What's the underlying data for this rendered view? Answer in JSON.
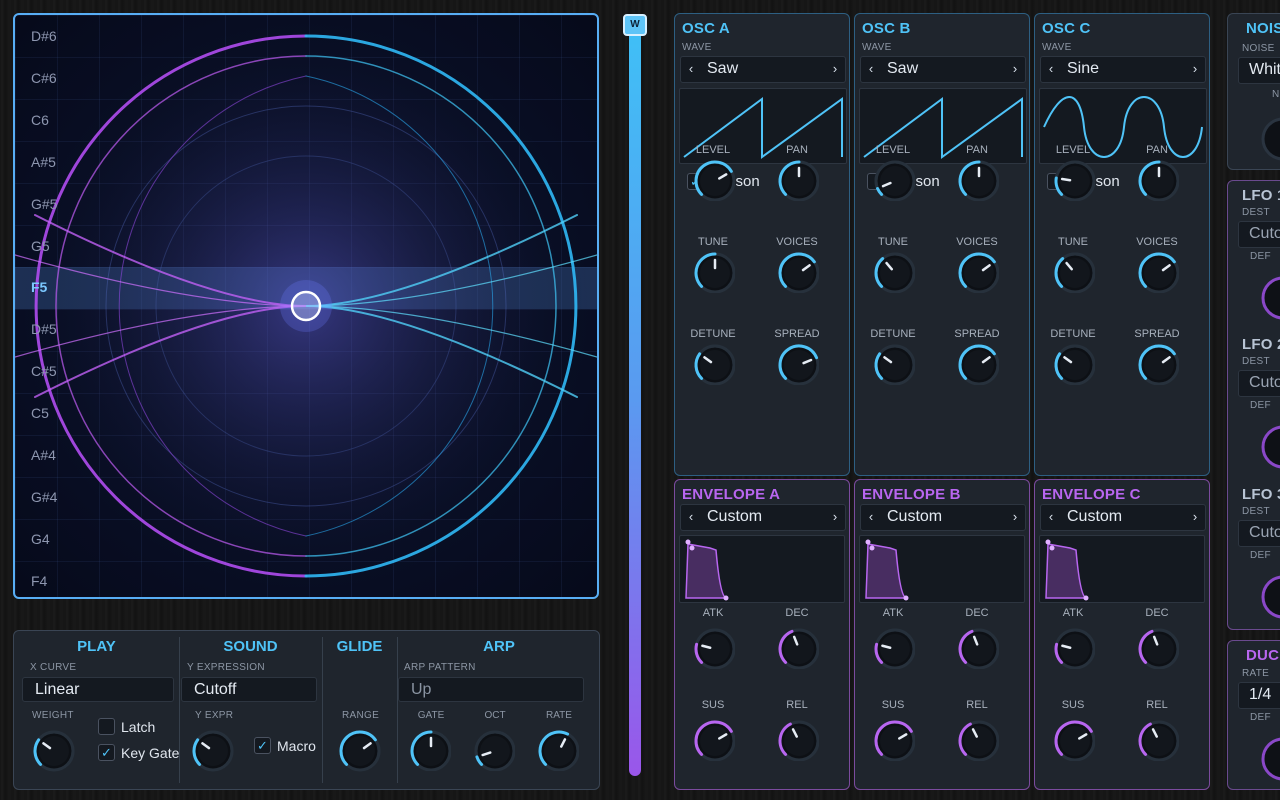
{
  "xy_pad": {
    "notes": [
      "D#6",
      "C#6",
      "C6",
      "A#5",
      "G#5",
      "G5",
      "F5",
      "D#5",
      "C#5",
      "C5",
      "A#4",
      "G#4",
      "G4",
      "F4"
    ],
    "active_note": "F5"
  },
  "slider": {
    "thumb_label": "W"
  },
  "oscillators": [
    {
      "title": "OSC A",
      "wave_label": "WAVE",
      "wave": "Saw",
      "unison_label": "Unison",
      "unison": true,
      "knobs": [
        {
          "label": "LEVEL",
          "value": 0.72
        },
        {
          "label": "PAN",
          "value": 0.5
        },
        {
          "label": "TUNE",
          "value": 0.5
        },
        {
          "label": "VOICES",
          "value": 0.7
        },
        {
          "label": "DETUNE",
          "value": 0.3
        },
        {
          "label": "SPREAD",
          "value": 0.75
        }
      ]
    },
    {
      "title": "OSC B",
      "wave_label": "WAVE",
      "wave": "Saw",
      "unison_label": "Unison",
      "unison": false,
      "knobs": [
        {
          "label": "LEVEL",
          "value": 0.08
        },
        {
          "label": "PAN",
          "value": 0.5
        },
        {
          "label": "TUNE",
          "value": 0.35
        },
        {
          "label": "VOICES",
          "value": 0.7
        },
        {
          "label": "DETUNE",
          "value": 0.3
        },
        {
          "label": "SPREAD",
          "value": 0.7
        }
      ]
    },
    {
      "title": "OSC C",
      "wave_label": "WAVE",
      "wave": "Sine",
      "unison_label": "Unison",
      "unison": false,
      "knobs": [
        {
          "label": "LEVEL",
          "value": 0.2
        },
        {
          "label": "PAN",
          "value": 0.5
        },
        {
          "label": "TUNE",
          "value": 0.35
        },
        {
          "label": "VOICES",
          "value": 0.7
        },
        {
          "label": "DETUNE",
          "value": 0.3
        },
        {
          "label": "SPREAD",
          "value": 0.7
        }
      ]
    }
  ],
  "envelopes": [
    {
      "title": "ENVELOPE A",
      "preset": "Custom",
      "knobs": [
        {
          "label": "ATK",
          "value": 0.22
        },
        {
          "label": "DEC",
          "value": 0.42
        },
        {
          "label": "SUS",
          "value": 0.72
        },
        {
          "label": "REL",
          "value": 0.4
        }
      ]
    },
    {
      "title": "ENVELOPE B",
      "preset": "Custom",
      "knobs": [
        {
          "label": "ATK",
          "value": 0.22
        },
        {
          "label": "DEC",
          "value": 0.42
        },
        {
          "label": "SUS",
          "value": 0.72
        },
        {
          "label": "REL",
          "value": 0.4
        }
      ]
    },
    {
      "title": "ENVELOPE C",
      "preset": "Custom",
      "knobs": [
        {
          "label": "ATK",
          "value": 0.22
        },
        {
          "label": "DEC",
          "value": 0.42
        },
        {
          "label": "SUS",
          "value": 0.72
        },
        {
          "label": "REL",
          "value": 0.4
        }
      ]
    }
  ],
  "right_panels": {
    "noise": {
      "title": "NOIS",
      "sub": "NOISE",
      "value": "Whit",
      "extra": "N"
    },
    "lfo1": {
      "title": "LFO 1",
      "sub": "DEST",
      "value": "Cuto",
      "extra": "DEF"
    },
    "lfo2": {
      "title": "LFO 2",
      "sub": "DEST",
      "value": "Cuto",
      "extra": "DEF"
    },
    "lfo3": {
      "title": "LFO 3",
      "sub": "DEST",
      "value": "Cuto",
      "extra": "DEF"
    },
    "duck": {
      "title": "DUC",
      "sub": "RATE",
      "value": "1/4",
      "extra": "DEF"
    }
  },
  "bottom": {
    "play": {
      "title": "PLAY",
      "x_curve_label": "X CURVE",
      "x_curve": "Linear",
      "weight_label": "WEIGHT",
      "weight": 0.3,
      "latch_label": "Latch",
      "latch": false,
      "keygate_label": "Key Gate",
      "keygate": true
    },
    "sound": {
      "title": "SOUND",
      "y_expression_label": "Y EXPRESSION",
      "y_expression": "Cutoff",
      "y_expr_label": "Y EXPR",
      "y_expr": 0.3,
      "macro_label": "Macro",
      "macro": true
    },
    "glide": {
      "title": "GLIDE",
      "range_label": "RANGE",
      "range": 0.7
    },
    "arp": {
      "title": "ARP",
      "pattern_label": "ARP PATTERN",
      "pattern": "Up",
      "knobs": [
        {
          "label": "GATE",
          "value": 0.5
        },
        {
          "label": "OCT",
          "value": 0.1
        },
        {
          "label": "RATE",
          "value": 0.6
        }
      ]
    }
  },
  "colors": {
    "osc_accent": "#4fc3f7",
    "env_accent": "#b866f0"
  }
}
